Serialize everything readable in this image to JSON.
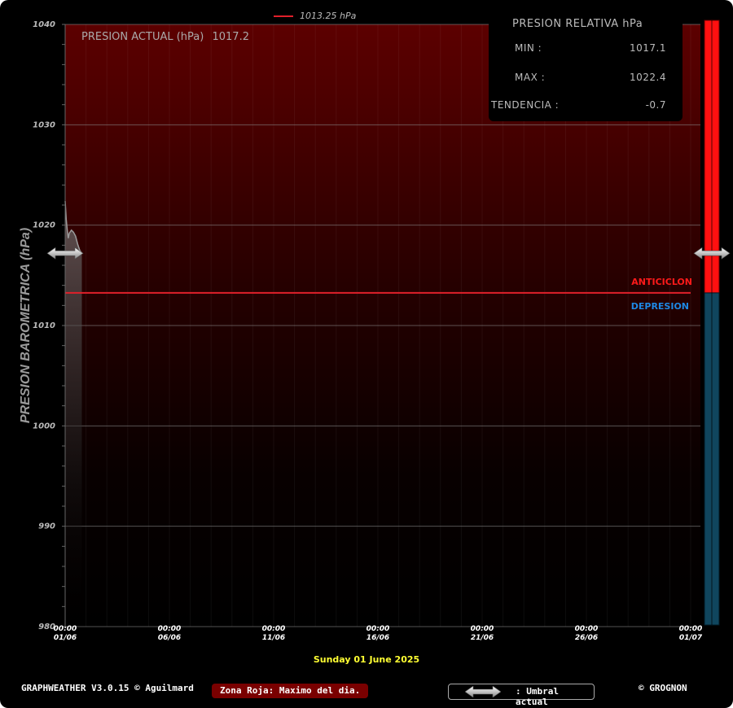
{
  "legend": {
    "label": "1013.25 hPa",
    "color": "#e0202a"
  },
  "current": {
    "label": "PRESION ACTUAL (hPa)",
    "value": "1017.2"
  },
  "stats": {
    "title": "PRESION RELATIVA hPa",
    "min_label": "MIN :",
    "min_value": "1017.1",
    "max_label": "MAX :",
    "max_value": "1022.4",
    "trend_label": "TENDENCIA :",
    "trend_value": "-0.7"
  },
  "ylabel": "PRESION BAROMETRICA (hPa)",
  "zones": {
    "high": "ANTICICLON",
    "low": "DEPRESION",
    "high_color": "#ff1a1a",
    "low_color": "#1e88e5"
  },
  "date_title": "Sunday 01 June 2025",
  "footer": {
    "credit": "GRAPHWEATHER V3.0.15 © Aguilmard",
    "zona": "Zona Roja: Maximo del dia.",
    "umbral": ": Umbral actual",
    "grognon": "© GROGNON"
  },
  "chart_data": {
    "type": "line",
    "title": "",
    "xlabel": "",
    "ylabel": "PRESION BAROMETRICA (hPa)",
    "ylim": [
      980,
      1040
    ],
    "yticks": [
      980,
      990,
      1000,
      1010,
      1020,
      1030,
      1040
    ],
    "xticks": [
      {
        "day": 0,
        "time": "00:00",
        "date": "01/06"
      },
      {
        "day": 5,
        "time": "00:00",
        "date": "06/06"
      },
      {
        "day": 10,
        "time": "00:00",
        "date": "11/06"
      },
      {
        "day": 15,
        "time": "00:00",
        "date": "16/06"
      },
      {
        "day": 20,
        "time": "00:00",
        "date": "21/06"
      },
      {
        "day": 25,
        "time": "00:00",
        "date": "26/06"
      },
      {
        "day": 30,
        "time": "00:00",
        "date": "01/07"
      }
    ],
    "xlim": [
      0,
      30
    ],
    "reference_line": {
      "value": 1013.25,
      "label": "1013.25 hPa",
      "color": "#e0202a"
    },
    "current_threshold": 1017.2,
    "series": [
      {
        "color": "#9a9a9a",
        "x": [
          0.0,
          0.05,
          0.1,
          0.15,
          0.2,
          0.3,
          0.4,
          0.5,
          0.6,
          0.7,
          0.8
        ],
        "y": [
          1022.4,
          1020.6,
          1019.5,
          1018.7,
          1019.2,
          1019.5,
          1019.3,
          1018.9,
          1018.1,
          1017.5,
          1017.2
        ]
      }
    ],
    "grid": true,
    "legend_position": "top-center"
  }
}
